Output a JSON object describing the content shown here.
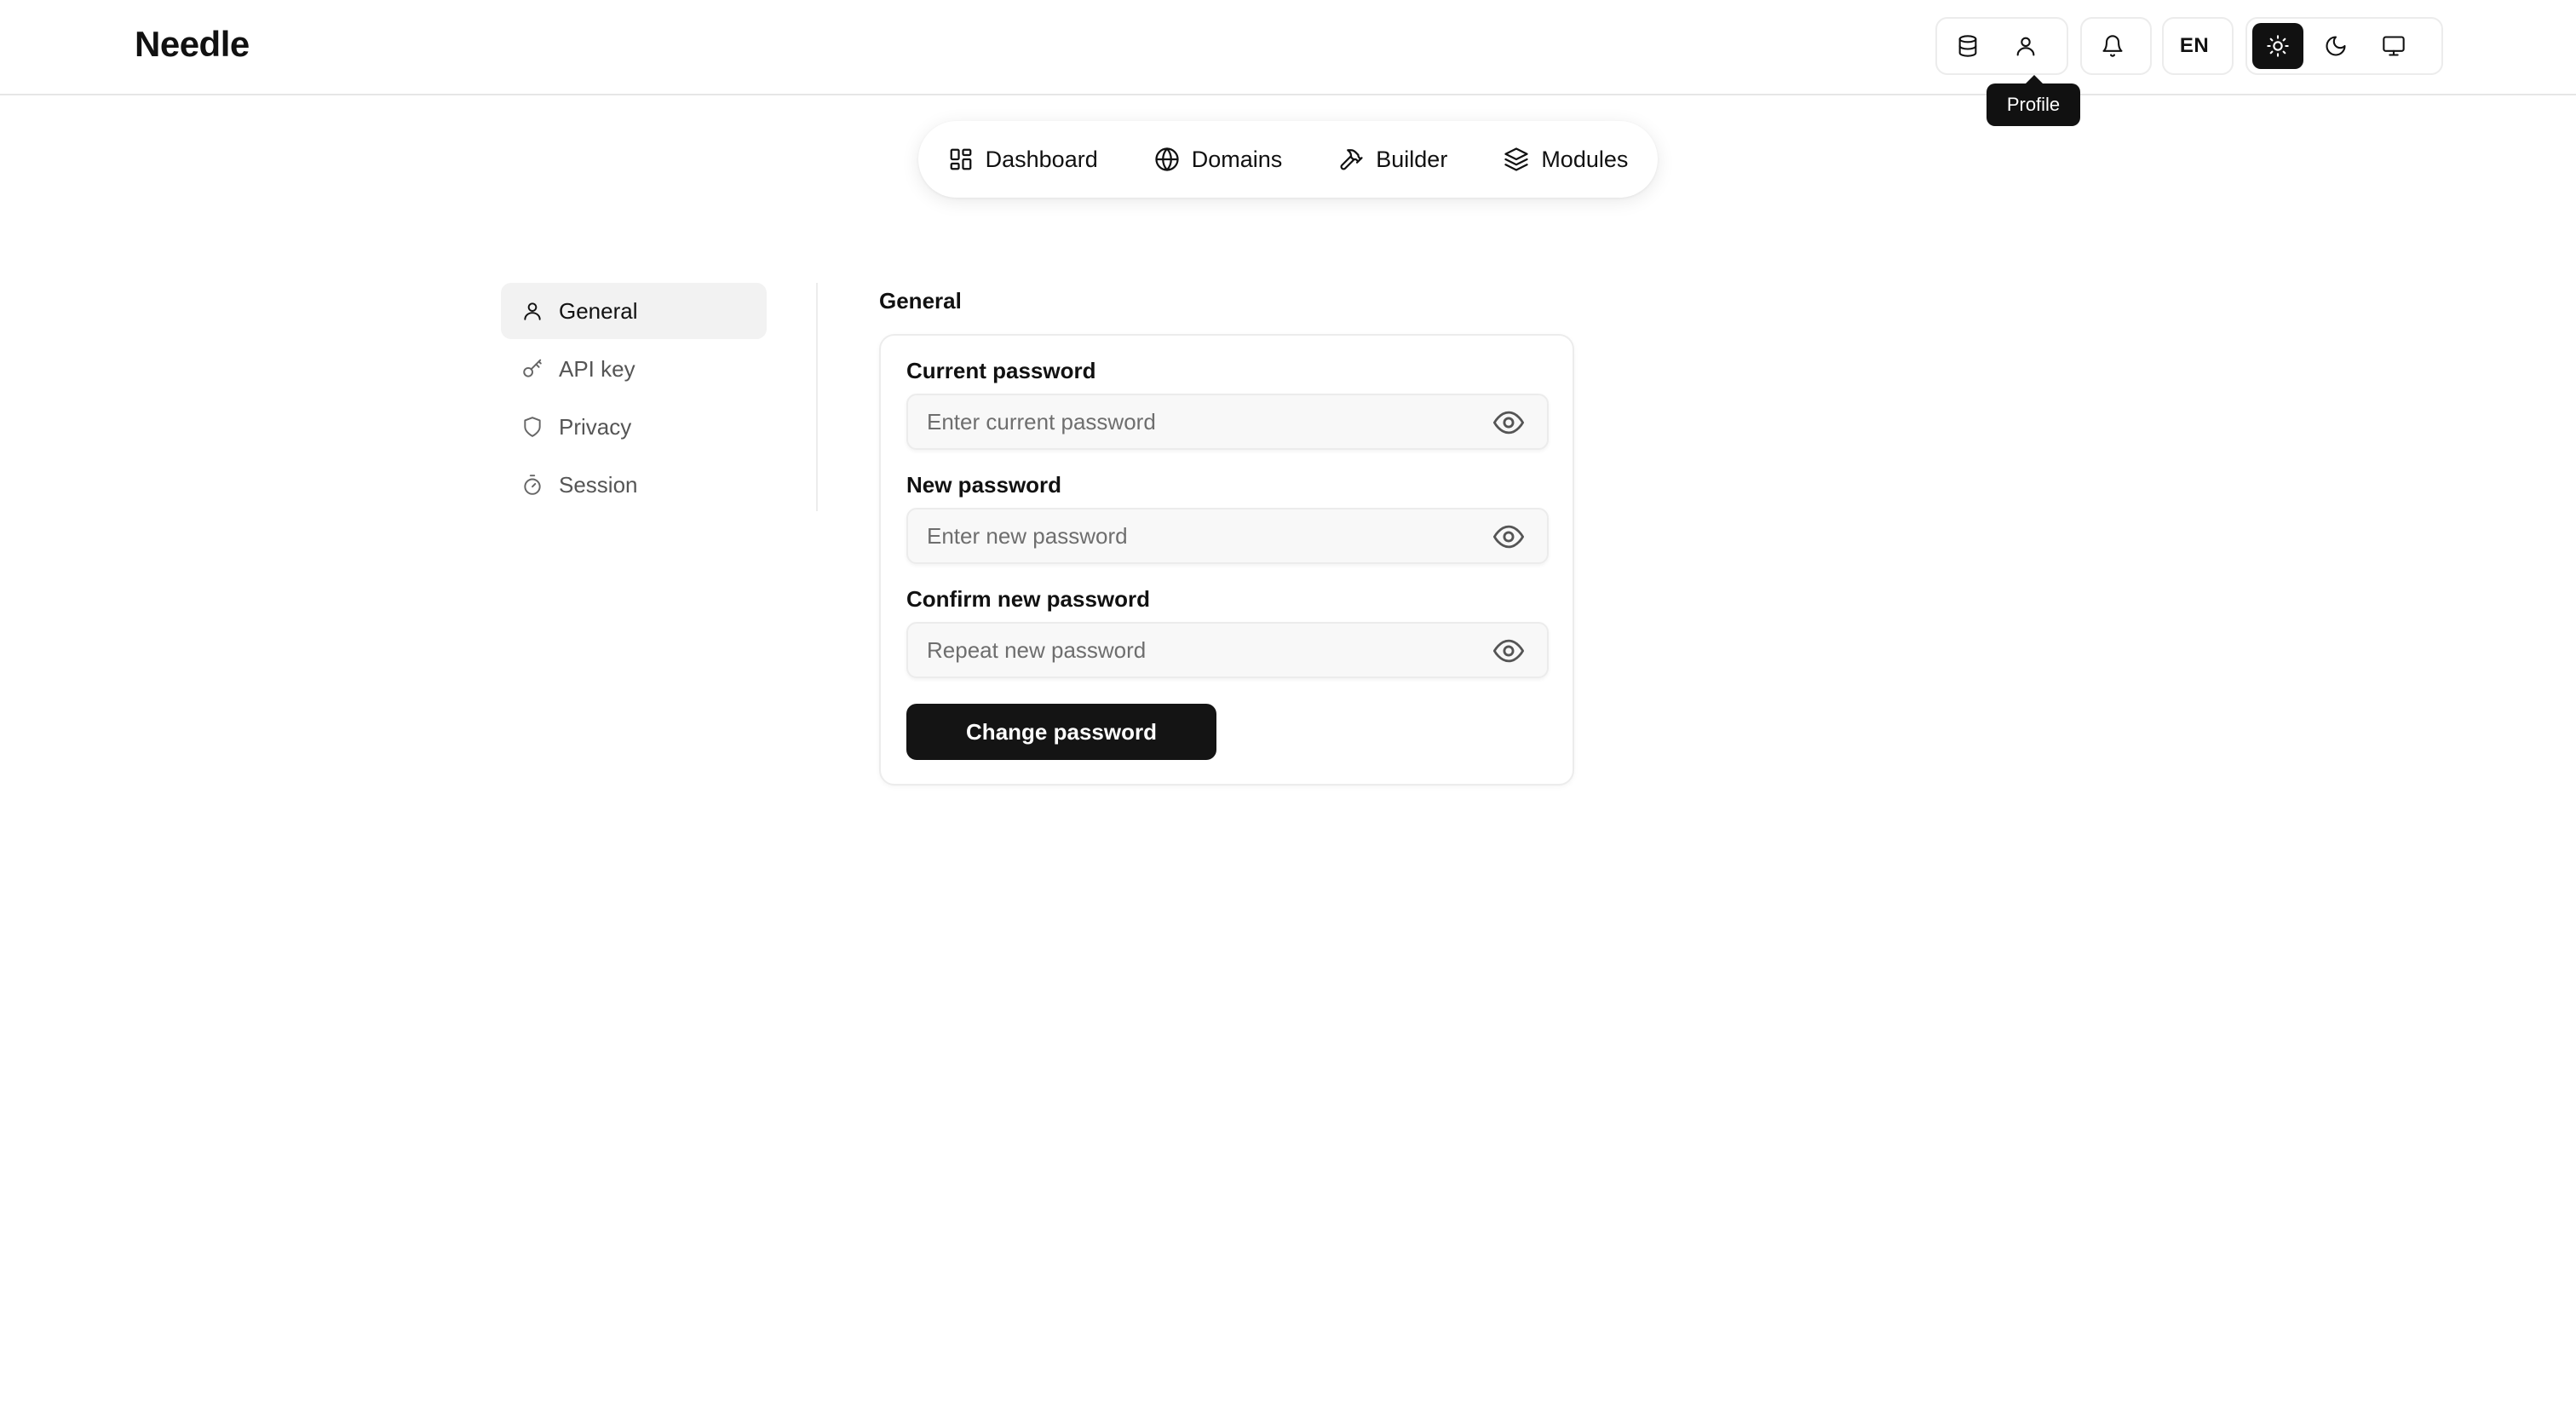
{
  "app": {
    "logo": "Needle"
  },
  "topbar": {
    "database_icon": "database-icon",
    "profile_icon": "user-icon",
    "notifications_icon": "bell-icon",
    "language": "EN",
    "theme_light_icon": "sun-icon",
    "theme_dark_icon": "moon-icon",
    "theme_system_icon": "monitor-icon",
    "active_theme": "light",
    "tooltip": "Profile"
  },
  "nav": {
    "items": [
      {
        "label": "Dashboard",
        "icon": "grid-icon"
      },
      {
        "label": "Domains",
        "icon": "globe-icon"
      },
      {
        "label": "Builder",
        "icon": "hammer-icon"
      },
      {
        "label": "Modules",
        "icon": "layers-icon"
      }
    ]
  },
  "sidebar": {
    "items": [
      {
        "label": "General",
        "icon": "user-icon",
        "active": true
      },
      {
        "label": "API key",
        "icon": "key-icon",
        "active": false
      },
      {
        "label": "Privacy",
        "icon": "shield-icon",
        "active": false
      },
      {
        "label": "Session",
        "icon": "timer-icon",
        "active": false
      }
    ]
  },
  "main": {
    "section_title": "General",
    "form": {
      "current_password": {
        "label": "Current password",
        "placeholder": "Enter current password",
        "value": ""
      },
      "new_password": {
        "label": "New password",
        "placeholder": "Enter new password",
        "value": ""
      },
      "confirm_password": {
        "label": "Confirm new password",
        "placeholder": "Repeat new password",
        "value": ""
      },
      "submit_label": "Change password"
    }
  },
  "colors": {
    "primary": "#141414",
    "border": "#ececec",
    "input_bg": "#f8f8f8",
    "muted_text": "#555555"
  }
}
